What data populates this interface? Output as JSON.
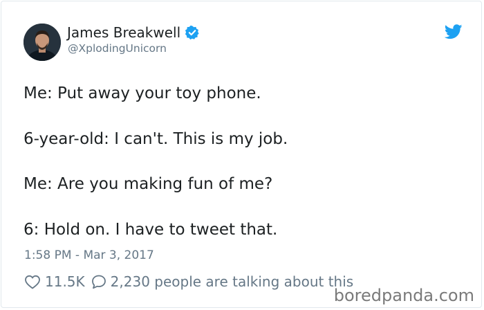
{
  "author": {
    "display_name": "James Breakwell",
    "handle": "@XplodingUnicorn",
    "verified_icon": "verified-badge-icon",
    "avatar_icon": "avatar"
  },
  "brand": {
    "icon": "twitter-bird-icon",
    "color": "#1da1f2"
  },
  "tweet": {
    "lines": [
      "Me: Put away your toy phone.",
      "6-year-old: I can't. This is my job.",
      "Me: Are you making fun of me?",
      "6: Hold on. I have to tweet that."
    ],
    "timestamp": "1:58 PM - Mar 3, 2017"
  },
  "engagement": {
    "like_icon": "heart-icon",
    "likes": "11.5K",
    "reply_icon": "speech-bubble-icon",
    "talking": "2,230 people are talking about this"
  },
  "watermark": "boredpanda.com",
  "colors": {
    "text": "#1c2022",
    "secondary": "#657786",
    "border": "#e1e8ed",
    "verified": "#1da1f2"
  }
}
